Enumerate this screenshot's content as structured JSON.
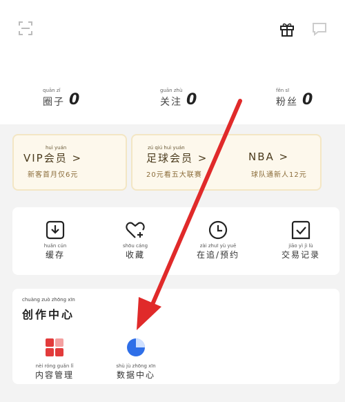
{
  "stats": [
    {
      "pinyin": "quān zǐ",
      "label": "圈子",
      "value": "0"
    },
    {
      "pinyin": "guān zhù",
      "label": "关注",
      "value": "0"
    },
    {
      "pinyin": "fěn sī",
      "label": "粉丝",
      "value": "0"
    }
  ],
  "cards": {
    "vip": {
      "pinyin": "huì yuán",
      "title": "VIP会员 >",
      "sub": "新客首月仅6元"
    },
    "football": {
      "pinyin": "zú qiú huì yuán",
      "title": "足球会员 >",
      "sub": "20元看五大联赛"
    },
    "nba": {
      "title": "NBA >",
      "sub": "球队通新人12元"
    }
  },
  "tools": [
    {
      "icon": "download-icon",
      "pinyin": "huǎn cún",
      "label": "缓存"
    },
    {
      "icon": "heart-plus-icon",
      "pinyin": "shōu cáng",
      "label": "收藏"
    },
    {
      "icon": "clock-icon",
      "pinyin": "zài zhuī yù yuē",
      "label": "在追/预约"
    },
    {
      "icon": "check-box-icon",
      "pinyin": "jiāo yì jì lù",
      "label": "交易记录"
    }
  ],
  "creation": {
    "pinyin": "chuàng zuò zhōng xīn",
    "heading": "创作中心",
    "items": [
      {
        "icon": "grid-icon",
        "pinyin": "nèi róng guǎn lǐ",
        "label": "内容管理"
      },
      {
        "icon": "pie-chart-icon",
        "pinyin": "shù jù zhōng xīn",
        "label": "数据中心"
      }
    ]
  },
  "colors": {
    "accent_red": "#e23b3b",
    "card_bg": "#fdf8ec",
    "pie_blue": "#2f6fe8"
  }
}
